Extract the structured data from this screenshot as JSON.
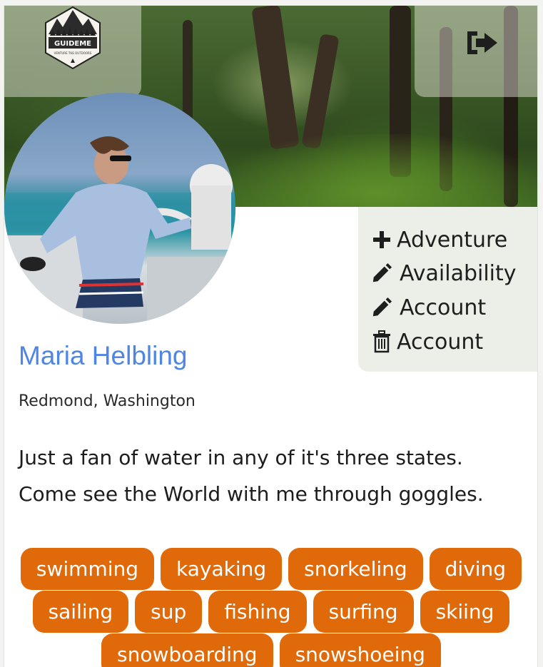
{
  "header": {
    "logo_text": "GUIDEME",
    "logo_tagline": "VENTURE THE OUTDOORS",
    "logout_icon": "sign-out-icon"
  },
  "profile": {
    "name": "Maria Helbling",
    "location": "Redmond, Washington",
    "bio_line1": "Just a fan of water in any of it's three states.",
    "bio_line2": "Come see the World with me through goggles."
  },
  "actions": [
    {
      "icon": "plus-icon",
      "label": "Adventure"
    },
    {
      "icon": "pencil-icon",
      "label": "Availability"
    },
    {
      "icon": "pencil-icon",
      "label": "Account"
    },
    {
      "icon": "trash-icon",
      "label": "Account"
    }
  ],
  "tags": [
    "swimming",
    "kayaking",
    "snorkeling",
    "diving",
    "sailing",
    "sup",
    "fishing",
    "surfing",
    "skiing",
    "snowboarding",
    "snowshoeing"
  ],
  "colors": {
    "name": "#4f86e4",
    "tag_bg": "#e06a0a",
    "panel_bg": "#ecefe8"
  }
}
